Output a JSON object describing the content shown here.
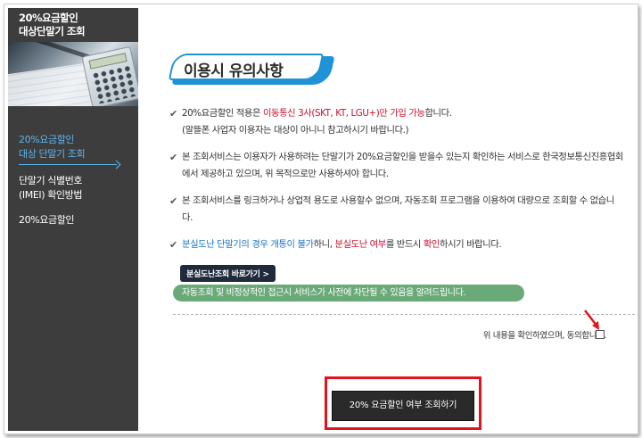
{
  "sidebar": {
    "title_line1": "20%요금할인",
    "title_line2": "대상단말기 조회",
    "menu": [
      {
        "line1": "20%요금할인",
        "line2": "대상 단말기 조회"
      },
      {
        "line1": "단말기 식별번호",
        "line2": "(IMEI) 확인방법"
      },
      {
        "line1": "20%요금할인",
        "line2": ""
      }
    ]
  },
  "header": {
    "title": "이용시 유의사항"
  },
  "notices": {
    "n1_a": "20%요금할인 적용은 ",
    "n1_b": "이동통신 3사(SKT, KT, LGU+)만 가입 가능",
    "n1_c": "합니다.",
    "n1_d": "(알뜰폰 사업자 이용자는 대상이 아니니 참고하시기  바랍니다.)",
    "n2": "본 조회서비스는 이용자가 사용하려는 단말기가 20%요금할인을 받을수 있는지 확인하는 서비스로 한국정보통신진흥협회에서 제공하고 있으며, 위 목적으로만 사용하셔야 합니다.",
    "n3": "본 조회서비스를 링크하거나 상업적 용도로 사용할수 없으며, 자동조회 프로그램을 이용하여 대량으로 조회할 수 없습니다.",
    "n4_a": "분실도난 단말기의 경우 개통이 불가",
    "n4_b": "하니, ",
    "n4_c": "분실도난 여부",
    "n4_d": "를 반드시 ",
    "n4_e": "확인",
    "n4_f": "하시기 바랍니다.",
    "lost_button": "분실도난조회 바로가기 >"
  },
  "warning_bar": "자동조회 및 비정상적인 접근시 서비스가 사전에 차단될 수 있음을 알려드립니다.",
  "agree_text": "위 내용을 확인하였으며, 동의합니다.",
  "query_button": "20% 요금할인 여부 조회하기",
  "colors": {
    "accent_blue": "#1f93d6",
    "highlight_red": "#e0141c",
    "notice_red": "#c8102e",
    "green_bar": "#6aaa79"
  }
}
